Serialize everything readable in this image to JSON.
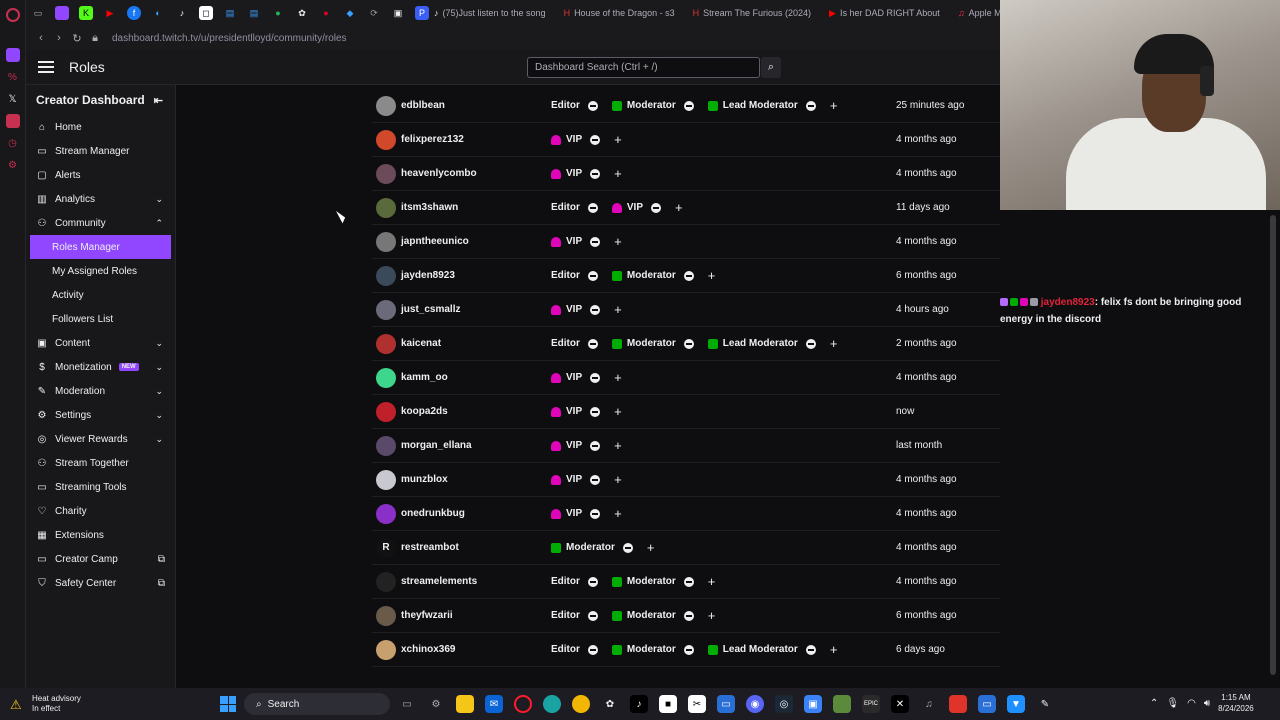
{
  "browser": {
    "tabs": [
      {
        "label": "(75)Just listen to the song",
        "icon": "tiktok-icon",
        "color": "#000000"
      },
      {
        "label": "House of the Dragon - s3",
        "icon": "hbo-icon",
        "color": "#7a1a1a"
      },
      {
        "label": "Stream The Furious (2024)",
        "icon": "stream-icon",
        "color": "#7a1a1a"
      },
      {
        "label": "Is her DAD RIGHT About",
        "icon": "youtube-icon",
        "color": "#ff0000"
      },
      {
        "label": "Apple Music - W",
        "icon": "apple-music-icon",
        "color": "#fa2d48"
      }
    ],
    "url": "dashboard.twitch.tv/u/presidentlloyd/community/roles"
  },
  "header": {
    "title": "Roles",
    "search_placeholder": "Dashboard Search (Ctrl + /)"
  },
  "sidenav": {
    "title": "Creator Dashboard",
    "items": [
      {
        "label": "Home",
        "icon": "home-icon",
        "chevron": ""
      },
      {
        "label": "Stream Manager",
        "icon": "stream-manager-icon",
        "chevron": ""
      },
      {
        "label": "Alerts",
        "icon": "alerts-icon",
        "chevron": ""
      },
      {
        "label": "Analytics",
        "icon": "analytics-icon",
        "chevron": "down"
      },
      {
        "label": "Community",
        "icon": "community-icon",
        "chevron": "up"
      },
      {
        "label": "Roles Manager",
        "sub": true,
        "active": true
      },
      {
        "label": "My Assigned Roles",
        "sub": true
      },
      {
        "label": "Activity",
        "sub": true
      },
      {
        "label": "Followers List",
        "sub": true
      },
      {
        "label": "Content",
        "icon": "content-icon",
        "chevron": "down"
      },
      {
        "label": "Monetization",
        "icon": "monetization-icon",
        "chevron": "down",
        "badge": "NEW"
      },
      {
        "label": "Moderation",
        "icon": "moderation-icon",
        "chevron": "down"
      },
      {
        "label": "Settings",
        "icon": "settings-icon",
        "chevron": "down"
      },
      {
        "label": "Viewer Rewards",
        "icon": "viewer-rewards-icon",
        "chevron": "down"
      },
      {
        "label": "Stream Together",
        "icon": "stream-together-icon"
      },
      {
        "label": "Streaming Tools",
        "icon": "streaming-tools-icon"
      },
      {
        "label": "Charity",
        "icon": "charity-icon"
      },
      {
        "label": "Extensions",
        "icon": "extensions-icon"
      },
      {
        "label": "Creator Camp",
        "icon": "creator-camp-icon",
        "external": true
      },
      {
        "label": "Safety Center",
        "icon": "safety-center-icon",
        "external": true
      }
    ]
  },
  "roles_table": {
    "rows": [
      {
        "user": "edblbean",
        "avatar_color": "#8a8a8a",
        "roles": [
          "Editor",
          "Moderator",
          "Lead Moderator"
        ],
        "added": "25 minutes ago"
      },
      {
        "user": "felixperez132",
        "avatar_color": "#d1482b",
        "roles": [
          "VIP"
        ],
        "added": "4 months ago"
      },
      {
        "user": "heavenlycombo",
        "avatar_color": "#6b4a5a",
        "roles": [
          "VIP"
        ],
        "added": "4 months ago"
      },
      {
        "user": "itsm3shawn",
        "avatar_color": "#5a6a3a",
        "roles": [
          "Editor",
          "VIP"
        ],
        "added": "11 days ago"
      },
      {
        "user": "japntheeunico",
        "avatar_color": "#777777",
        "roles": [
          "VIP"
        ],
        "added": "4 months ago"
      },
      {
        "user": "jayden8923",
        "avatar_color": "#3a4a5a",
        "roles": [
          "Editor",
          "Moderator"
        ],
        "added": "6 months ago"
      },
      {
        "user": "just_csmallz",
        "avatar_color": "#6a6a7a",
        "roles": [
          "VIP"
        ],
        "added": "4 hours ago"
      },
      {
        "user": "kaicenat",
        "avatar_color": "#b03030",
        "roles": [
          "Editor",
          "Moderator",
          "Lead Moderator"
        ],
        "added": "2 months ago"
      },
      {
        "user": "kamm_oo",
        "avatar_color": "#3dd68c",
        "roles": [
          "VIP"
        ],
        "added": "4 months ago"
      },
      {
        "user": "koopa2ds",
        "avatar_color": "#c0202a",
        "roles": [
          "VIP"
        ],
        "added": "now"
      },
      {
        "user": "morgan_ellana",
        "avatar_color": "#5a4a6a",
        "roles": [
          "VIP"
        ],
        "added": "last month"
      },
      {
        "user": "munzblox",
        "avatar_color": "#c8c8d0",
        "roles": [
          "VIP"
        ],
        "added": "4 months ago"
      },
      {
        "user": "onedrunkbug",
        "avatar_color": "#8b2fc9",
        "roles": [
          "VIP"
        ],
        "added": "4 months ago"
      },
      {
        "user": "restreambot",
        "avatar_color": "#111111",
        "avatar_letter": "R",
        "roles": [
          "Moderator"
        ],
        "added": "4 months ago"
      },
      {
        "user": "streamelements",
        "avatar_color": "#222222",
        "roles": [
          "Editor",
          "Moderator"
        ],
        "added": "4 months ago"
      },
      {
        "user": "theyfwzarii",
        "avatar_color": "#6a5a4a",
        "roles": [
          "Editor",
          "Moderator"
        ],
        "added": "6 months ago"
      },
      {
        "user": "xchinox369",
        "avatar_color": "#c8a070",
        "roles": [
          "Editor",
          "Moderator",
          "Lead Moderator"
        ],
        "added": "6 days ago"
      }
    ]
  },
  "chat": {
    "chatter": "jayden8923",
    "message": ": felix fs dont be bringing good energy in the discord"
  },
  "taskbar": {
    "weather_title": "Heat advisory",
    "weather_sub": "In effect",
    "search_label": "Search",
    "time": "1:15 AM",
    "date": "8/24/2026"
  },
  "colors": {
    "accent": "#9147ff",
    "vip": "#e005b9",
    "moderator": "#00ad03"
  }
}
